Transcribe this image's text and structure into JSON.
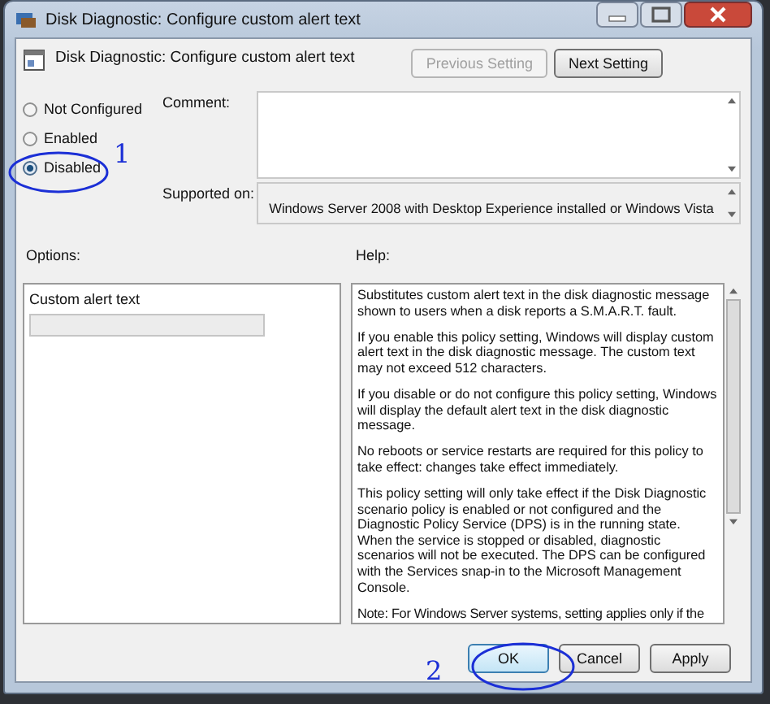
{
  "window": {
    "title": "Disk Diagnostic: Configure custom alert text"
  },
  "header": {
    "title": "Disk Diagnostic: Configure custom alert text"
  },
  "nav_buttons": [
    {
      "label": "Previous Setting",
      "disabled": true
    },
    {
      "label": "Next Setting",
      "disabled": false
    }
  ],
  "states": [
    {
      "label": "Not Configured",
      "selected": false
    },
    {
      "label": "Enabled",
      "selected": false
    },
    {
      "label": "Disabled",
      "selected": true
    }
  ],
  "comment": {
    "label": "Comment:"
  },
  "supported_on": {
    "label": "Supported on:",
    "value": "Windows Server 2008 with Desktop Experience installed or Windows Vista"
  },
  "options": {
    "label": "Options:",
    "field_label": "Custom alert text",
    "field_disabled": true
  },
  "help": {
    "label": "Help:",
    "paragraphs": [
      "Substitutes custom alert text in the disk diagnostic message shown to users when a disk reports a S.M.A.R.T. fault.",
      "If you enable this policy setting, Windows will display custom alert text in the disk diagnostic message.  The custom text may not exceed 512 characters.",
      "If you disable or do not configure this policy setting, Windows will display the default alert text in the disk diagnostic message.",
      "No reboots or service restarts are required for this policy to take effect: changes take effect immediately.",
      "This policy setting will only take effect if the Disk Diagnostic scenario policy is enabled or not configured and the Diagnostic Policy Service (DPS) is in the running state.  When the service is stopped or disabled, diagnostic scenarios will not be executed. The DPS can be configured with the Services snap-in to the Microsoft Management Console.",
      "Note: For Windows Server systems, setting applies only if the"
    ]
  },
  "footer_buttons": [
    "OK",
    "Cancel",
    "Apply"
  ],
  "annotations": [
    {
      "text": "1"
    },
    {
      "text": "2"
    }
  ]
}
